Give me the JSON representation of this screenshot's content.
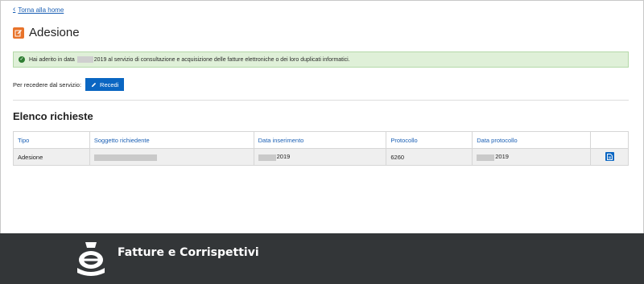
{
  "nav": {
    "back_label": "Torna alla home"
  },
  "page": {
    "title": "Adesione"
  },
  "alert": {
    "text_before": "Hai aderito in data",
    "text_after": "2019 al servizio di consultazione e acquisizione delle fatture elettroniche o dei loro duplicati informatici."
  },
  "recede": {
    "label": "Per recedere dal servizio:",
    "button_label": "Recedi"
  },
  "requests": {
    "title": "Elenco richieste",
    "headers": [
      "Tipo",
      "Soggetto richiedente",
      "Data inserimento",
      "Protocollo",
      "Data protocollo",
      ""
    ],
    "rows": [
      {
        "tipo": "Adesione",
        "data_inserimento": "2019",
        "protocollo": "6260",
        "data_protocollo": "2019"
      }
    ]
  },
  "footer": {
    "title": "Fatture e Corrispettivi"
  },
  "colors": {
    "accent": "#0a66c2",
    "title_icon": "#e8732a",
    "alert_bg": "#dff0d8",
    "footer_bg": "#333638"
  },
  "icons": [
    "chevron-left-icon",
    "edit-icon",
    "check-circle-icon",
    "pencil-icon",
    "document-icon",
    "agenzia-entrate-logo"
  ]
}
